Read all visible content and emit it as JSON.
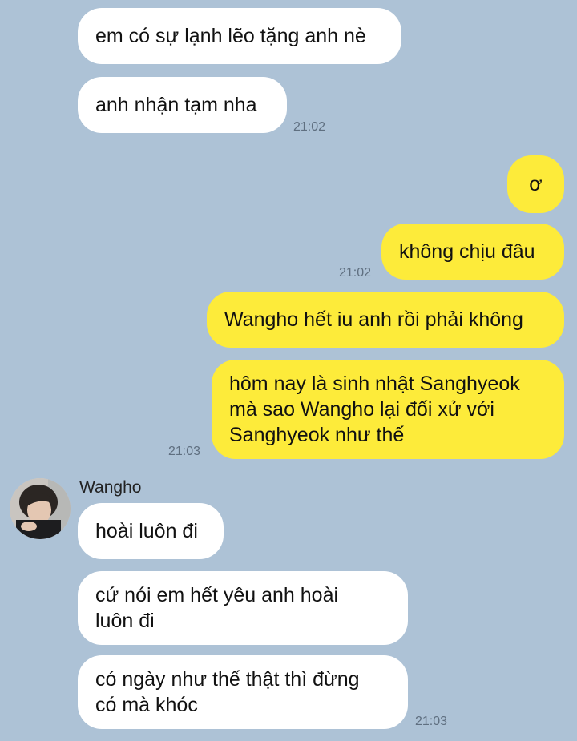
{
  "colors": {
    "background": "#adc2d6",
    "incoming_bubble": "#ffffff",
    "outgoing_bubble": "#fdeb3a",
    "timestamp": "#5f6f80"
  },
  "messages": [
    {
      "side": "incoming",
      "text": "em có sự lạnh lẽo tặng anh nè"
    },
    {
      "side": "incoming",
      "text": "anh nhận tạm nha",
      "time": "21:02"
    },
    {
      "side": "outgoing",
      "text": "ơ"
    },
    {
      "side": "outgoing",
      "text": "không chịu đâu",
      "time": "21:02"
    },
    {
      "side": "outgoing",
      "text": "Wangho hết iu anh rồi phải không"
    },
    {
      "side": "outgoing",
      "text": "hôm nay là sinh nhật Sanghyeok\nmà sao Wangho lại đối xử với\nSanghyeok như thế",
      "time": "21:03"
    },
    {
      "side": "incoming",
      "sender": "Wangho",
      "avatar_icon": "profile-photo",
      "text": "hoài luôn đi"
    },
    {
      "side": "incoming",
      "text": "cứ nói em hết yêu anh hoài\nluôn đi"
    },
    {
      "side": "incoming",
      "text": "có ngày như thế thật thì đừng\ncó mà khóc",
      "time": "21:03"
    }
  ]
}
